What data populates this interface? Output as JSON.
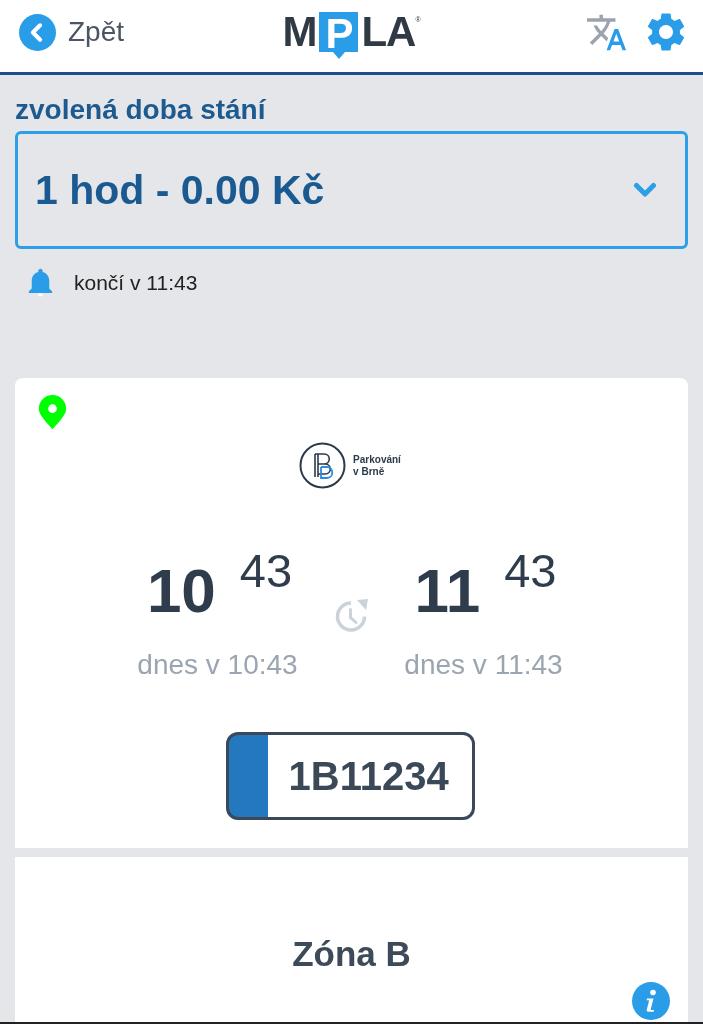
{
  "header": {
    "back": {
      "label": "Zpět"
    },
    "logo": {
      "before": "M",
      "highlight": "P",
      "after": "LA",
      "mark": "®"
    }
  },
  "duration": {
    "label": "zvolená doba stání",
    "value": "1 hod - 0.00 Kč"
  },
  "reminder": {
    "text": "končí v 11:43"
  },
  "ticket": {
    "provider": [
      "Parkování",
      "v Brně"
    ],
    "start": {
      "hour": "10",
      "minute": "43",
      "caption": "dnes v 10:43"
    },
    "end": {
      "hour": "11",
      "minute": "43",
      "caption": "dnes v 11:43"
    },
    "plate": "1B11234"
  },
  "zone": {
    "title": "Zóna B"
  }
}
